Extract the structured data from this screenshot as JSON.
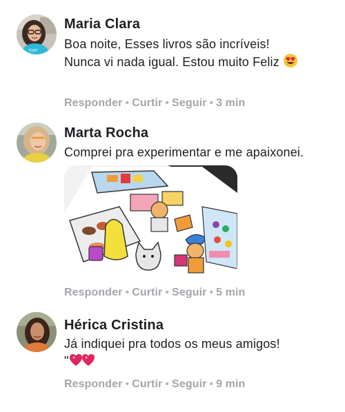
{
  "comments": [
    {
      "author": "Maria Clara",
      "lines": [
        "Boa noite, Esses livros são incríveis!",
        "Nunca vi nada igual. Estou muito Feliz"
      ],
      "emoji": "heart-eyes-emoji",
      "actions": {
        "reply": "Responder",
        "like": "Curtir",
        "follow": "Seguir",
        "time": "3 min"
      }
    },
    {
      "author": "Marta Rocha",
      "lines": [
        "Comprei pra experimentar e me apaixonei."
      ],
      "image": "coloring-book-photo",
      "actions": {
        "reply": "Responder",
        "like": "Curtir",
        "follow": "Seguir",
        "time": "5 min"
      }
    },
    {
      "author": "Hérica Cristina",
      "lines": [
        "Já indiquei pra todos os meus amigos!",
        "\""
      ],
      "emoji": "heart-emoji",
      "actions": {
        "reply": "Responder",
        "like": "Curtir",
        "follow": "Seguir",
        "time": "9 min"
      }
    }
  ],
  "separator": "•",
  "colors": {
    "text": "#1c1e21",
    "meta": "#a3a5aa"
  }
}
